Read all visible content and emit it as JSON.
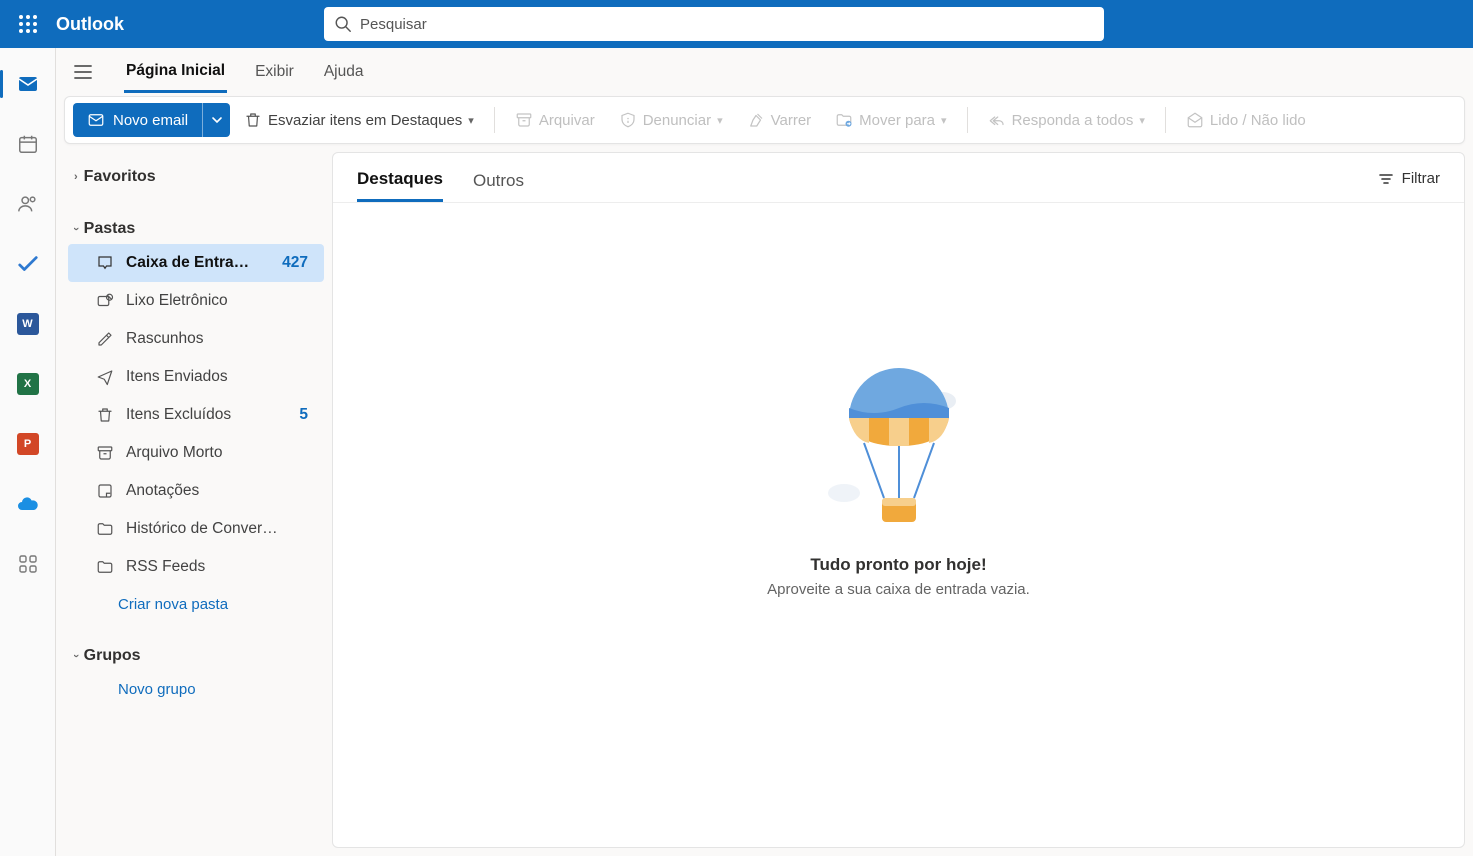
{
  "topbar": {
    "brand": "Outlook",
    "search_placeholder": "Pesquisar"
  },
  "ribbon_tabs": {
    "home": "Página Inicial",
    "view": "Exibir",
    "help": "Ajuda"
  },
  "commands": {
    "new_email": "Novo email",
    "empty_focused": "Esvaziar itens em Destaques",
    "archive": "Arquivar",
    "report": "Denunciar",
    "sweep": "Varrer",
    "move_to": "Mover para",
    "reply_all": "Responda a todos",
    "read_unread": "Lido / Não lido"
  },
  "sections": {
    "favorites": "Favoritos",
    "folders": "Pastas",
    "groups": "Grupos"
  },
  "folders": {
    "inbox": {
      "label": "Caixa de Entra…",
      "count": "427"
    },
    "junk": {
      "label": "Lixo Eletrônico"
    },
    "drafts": {
      "label": "Rascunhos"
    },
    "sent": {
      "label": "Itens Enviados"
    },
    "deleted": {
      "label": "Itens Excluídos",
      "count": "5"
    },
    "archive": {
      "label": "Arquivo Morto"
    },
    "notes": {
      "label": "Anotações"
    },
    "history": {
      "label": "Histórico de Conver…"
    },
    "rss": {
      "label": "RSS Feeds"
    },
    "create": "Criar nova pasta",
    "new_group": "Novo grupo"
  },
  "pane": {
    "focused": "Destaques",
    "other": "Outros",
    "filter": "Filtrar"
  },
  "empty_state": {
    "title": "Tudo pronto por hoje!",
    "subtitle": "Aproveite a sua caixa de entrada vazia."
  }
}
